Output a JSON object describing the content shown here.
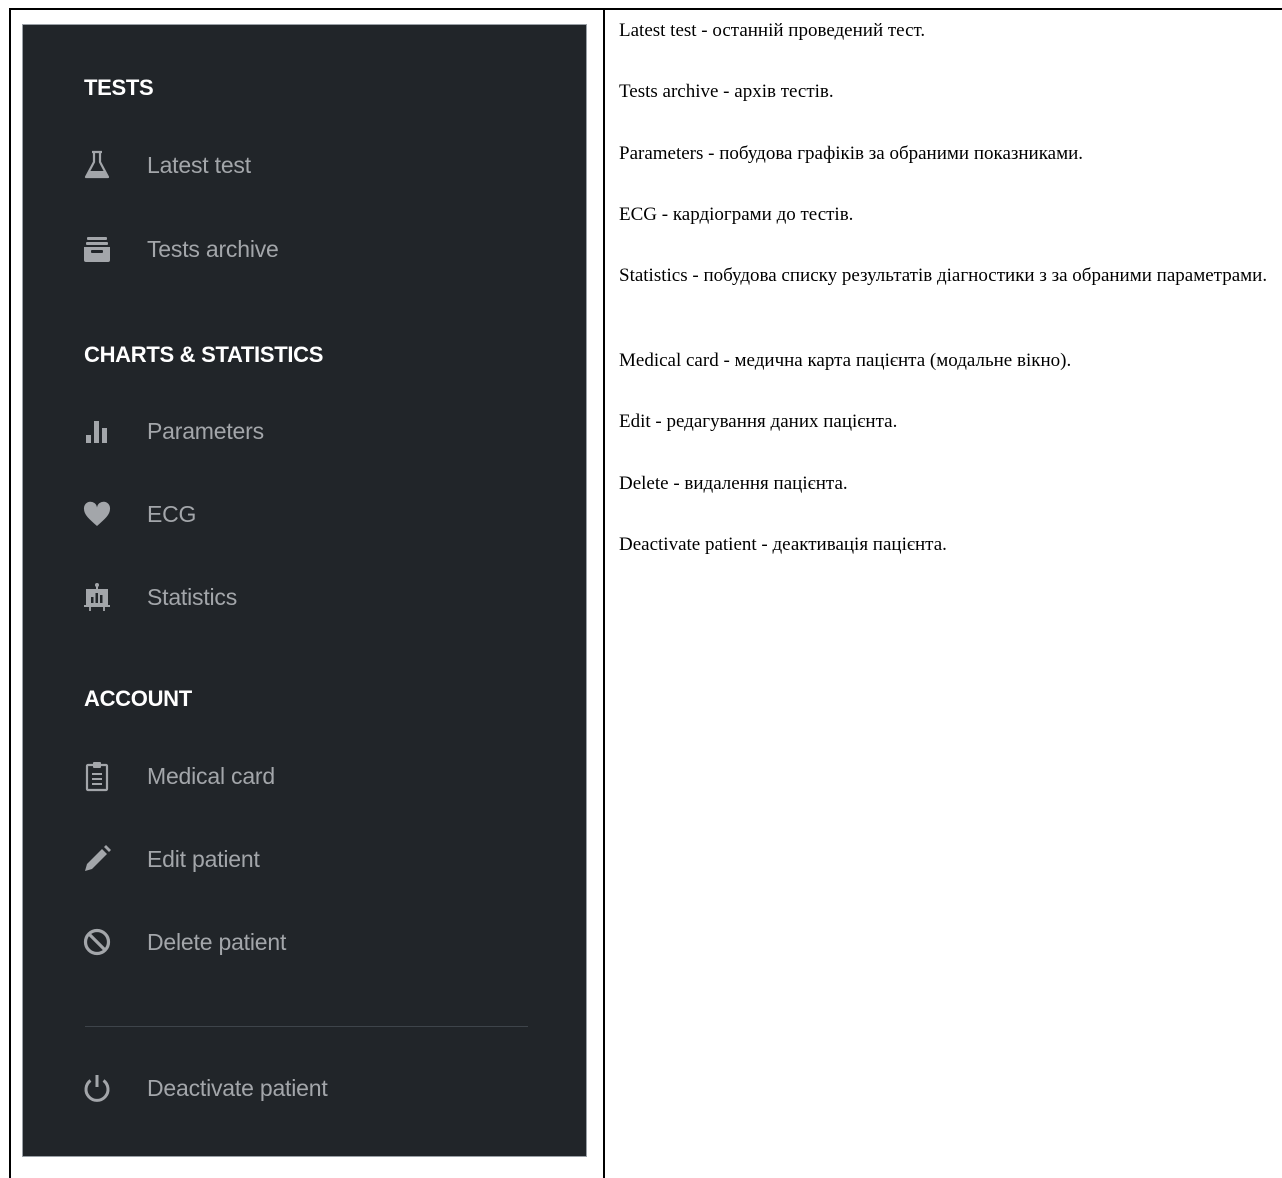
{
  "sidebar": {
    "sections": [
      {
        "title": "TESTS"
      },
      {
        "title": "CHARTS & STATISTICS"
      },
      {
        "title": "ACCOUNT"
      }
    ],
    "items": [
      {
        "label": "Latest test",
        "icon": "flask-icon"
      },
      {
        "label": "Tests archive",
        "icon": "archive-icon"
      },
      {
        "label": "Parameters",
        "icon": "bar-chart-icon"
      },
      {
        "label": "ECG",
        "icon": "heart-icon"
      },
      {
        "label": "Statistics",
        "icon": "presentation-chart-icon"
      },
      {
        "label": "Medical card",
        "icon": "clipboard-icon"
      },
      {
        "label": "Edit patient",
        "icon": "pencil-icon"
      },
      {
        "label": "Delete patient",
        "icon": "ban-icon"
      },
      {
        "label": "Deactivate patient",
        "icon": "power-icon"
      }
    ]
  },
  "descriptions": [
    "Latest test - останній проведений тест.",
    "Tests archive - архів тестів.",
    "Parameters - побудова графіків за обраними показниками.",
    "ECG - кардіограми до тестів.",
    "Statistics - побудова списку результатів діагностики з за обраними параметрами.",
    "Medical card - медична карта пацієнта (модальне вікно).",
    "Edit - редагування даних пацієнта.",
    "Delete - видалення пацієнта.",
    "Deactivate patient - деактивація пацієнта."
  ],
  "colors": {
    "sidebar_bg": "#212529",
    "header_text": "#ffffff",
    "item_text": "#a3a6aa"
  }
}
